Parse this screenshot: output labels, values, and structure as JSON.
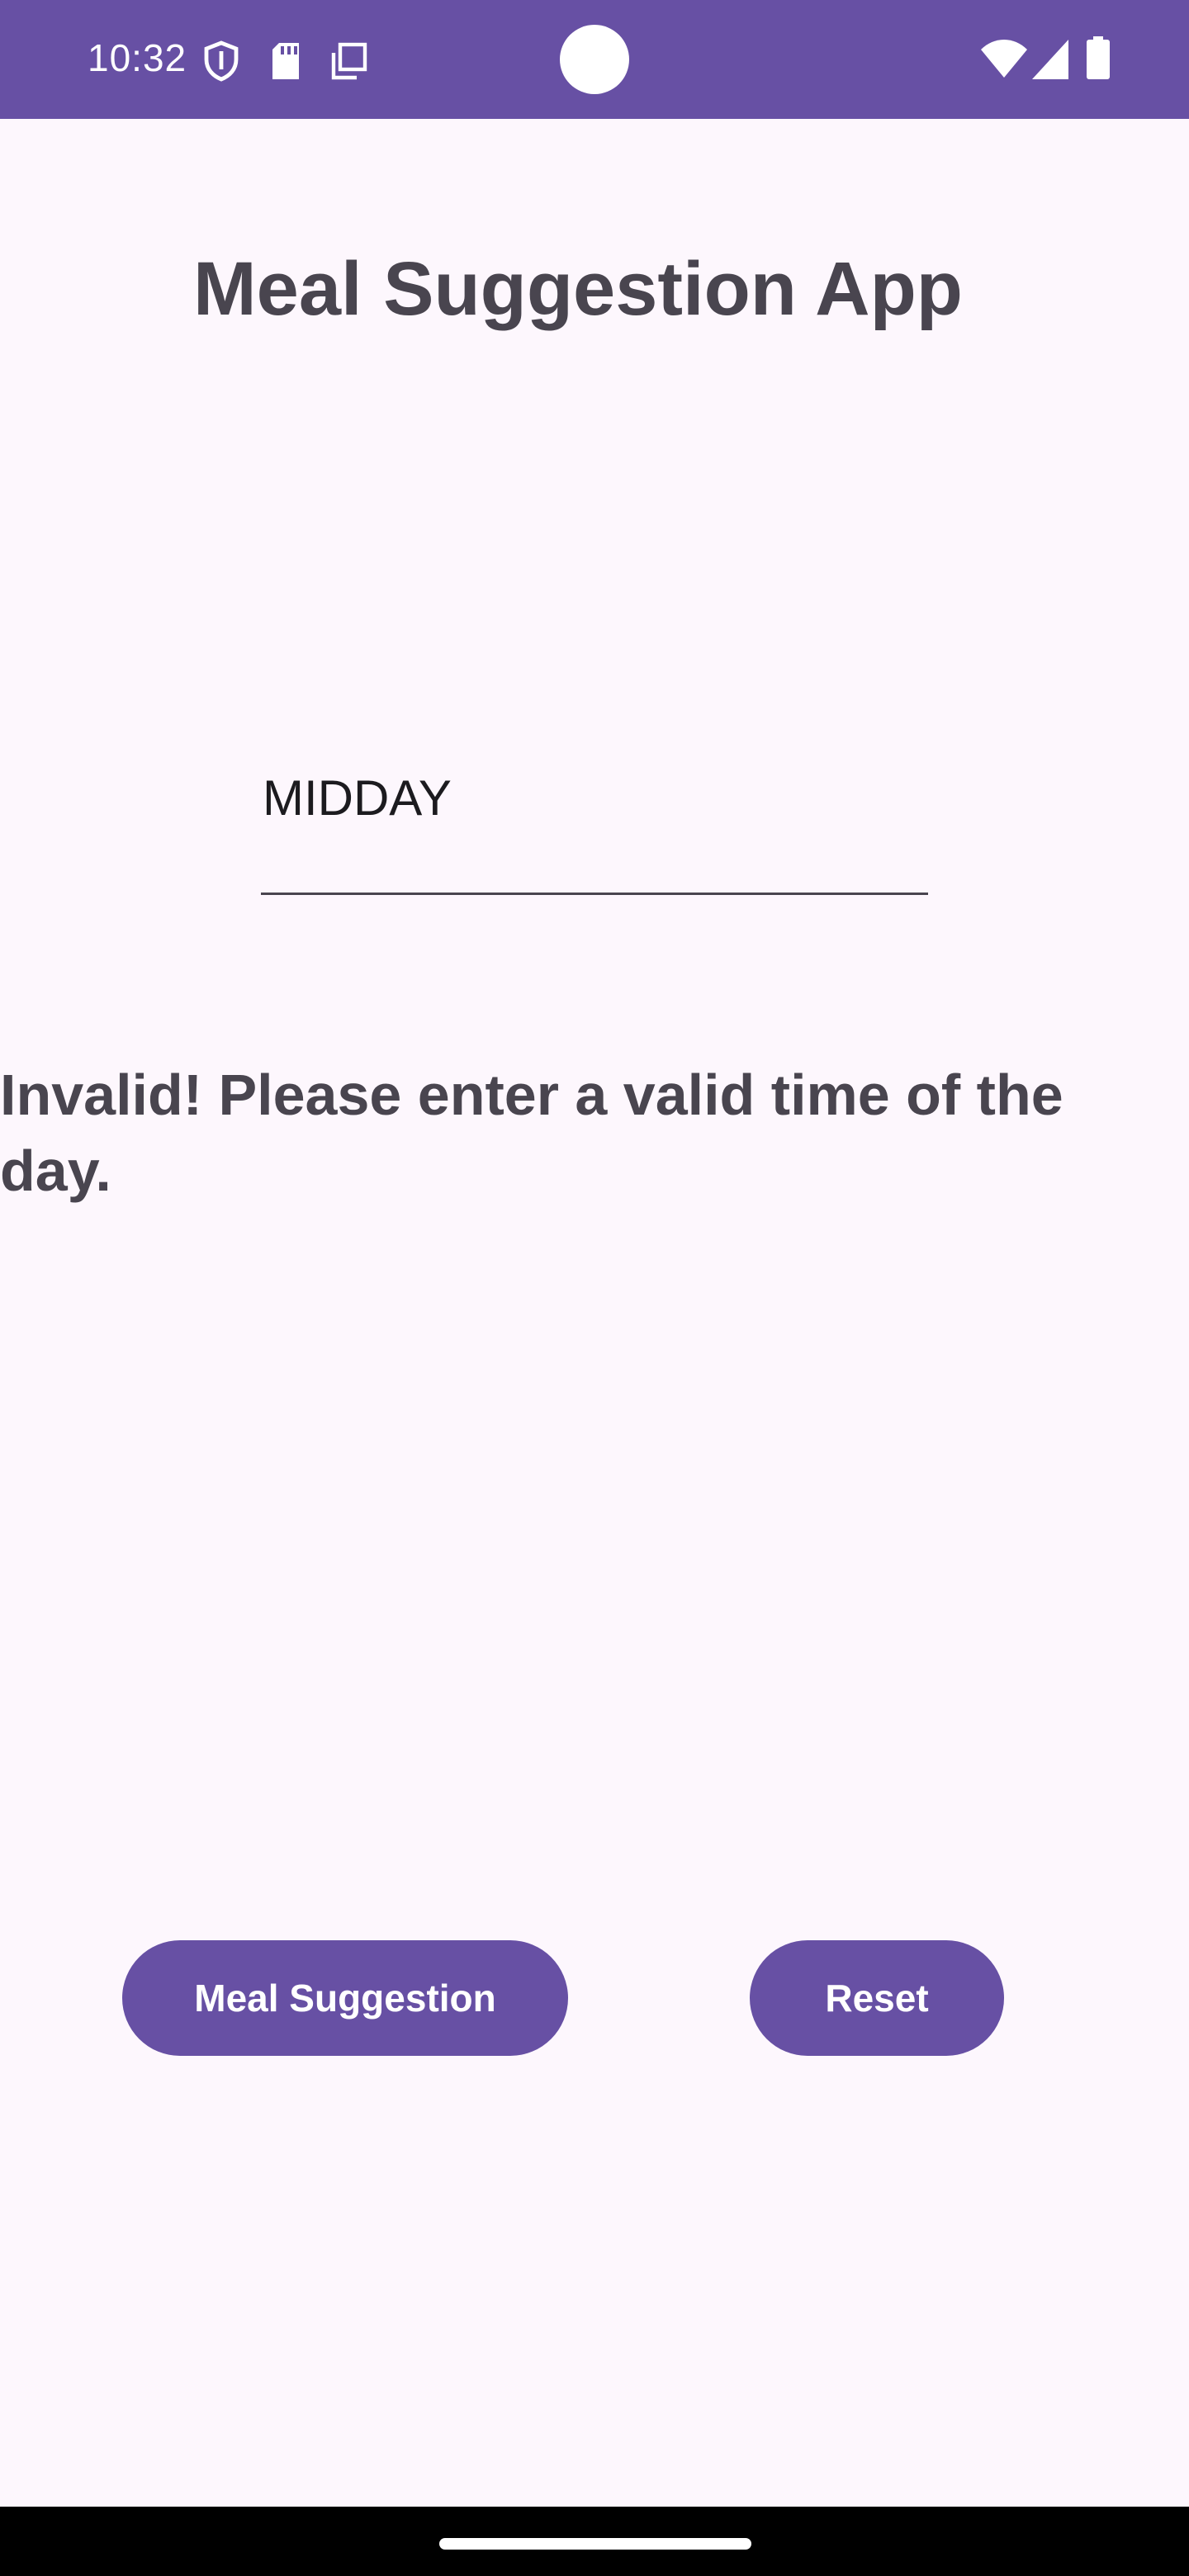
{
  "status_bar": {
    "time": "10:32",
    "background_color": "#6750a4",
    "left_icons": [
      "shield-icon",
      "sd-card-icon",
      "copy-icon"
    ],
    "right_icons": [
      "wifi-icon",
      "signal-icon",
      "battery-icon"
    ]
  },
  "app": {
    "title": "Meal Suggestion App"
  },
  "time_input": {
    "value": "MIDDAY"
  },
  "message": {
    "text": "Invalid! Please enter a valid time of the day."
  },
  "buttons": {
    "meal_suggestion_label": "Meal Suggestion",
    "reset_label": "Reset",
    "color": "#6750a4"
  },
  "colors": {
    "background": "#fdf7fd",
    "text": "#49454f"
  }
}
